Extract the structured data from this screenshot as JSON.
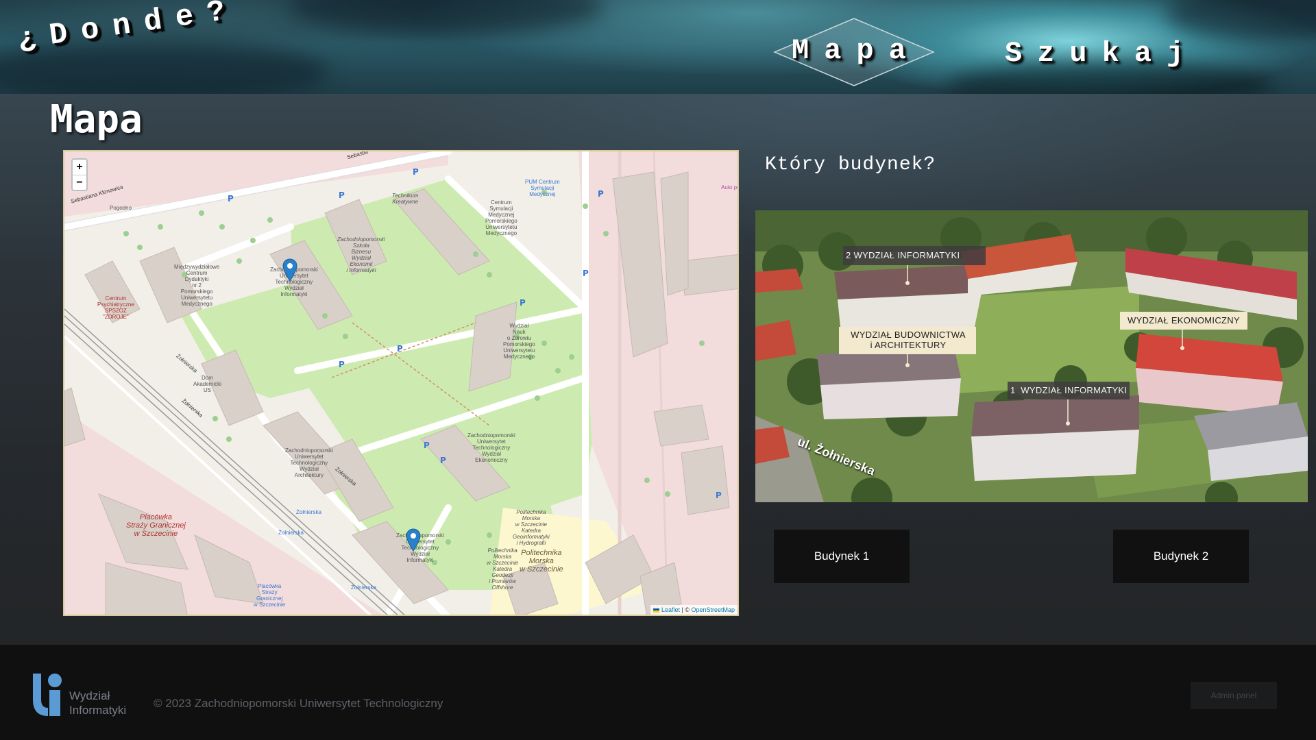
{
  "header": {
    "logo_text": "¿Donde?",
    "nav": {
      "mapa": "Mapa",
      "szukaj": "Szukaj"
    }
  },
  "main": {
    "title": "Mapa",
    "question": "Który budynek?",
    "map": {
      "zoom_in": "+",
      "zoom_out": "−",
      "attribution_leaflet": "Leaflet",
      "attribution_separator": " | © ",
      "attribution_osm": "OpenStreetMap",
      "labels": {
        "street_sebastiana": "Sebastiana Klonowica",
        "street_sebastia": "Sebastia",
        "street_zolnierska_1": "Żołnierska",
        "street_zolnierska_2": "Żołnierska",
        "street_zolnierska_3": "Żołnierska",
        "zut_wi_top": "Zachodniopomorski\nUniwersytet\nTechnologiczny\nWydział\nInformatyki",
        "zut_wi_bottom": "Zachodniopomorski\nUniwersytet\nTechnologiczny\nWydział\nInformatyki",
        "zut_architektury": "Zachodniopomorski\nUniwersytet\nTechnologiczny\nWydział\nArchitektury",
        "zut_ekonomiczny": "Zachodniopomorski\nUniwersytet\nTechnologiczny\nWydział\nEkonomiczny",
        "szkola_biznesu": "Zachodniopomorski\nSzkoła\nBiznesu\nWydział\nEkonomii\ni Informatyki",
        "centrum_dydaktyczne": "Międzywydziałowe\nCentrum\nDydaktyki\nnr 2\nPomorskiego\nUniwersytetu\nMedycznego",
        "centrum_symulacji": "Centrum\nSymulacji\nMedycznej\nPomorskiego\nUniwersytetu\nMedycznego",
        "pum_centrum": "PUM Centrum\nSymulacji\nMedycznej",
        "technikum": "Technikum\nKreatywne",
        "wydzial_nauk": "Wydział\nNauk\no Zdrowiu\nPomorskiego\nUniwersytetu\nMedycznego",
        "dom_akademicki": "Dom\nAkademicki\nUS",
        "centrum_psychiatryczne": "Centrum\nPsychiatryczne\nSPSZOZ\n\"ZDROJE\"",
        "placowka_strazy": "Placówka\nStraży Granicznej\nw Szczecinie",
        "politechnika_morska": "Politechnika\nMorska\nw Szczecinie",
        "politechnika_katedra": "Politechnika\nMorska\nw Szczecinie\nKatedra\nGeoinformatyki\ni Hydrografii",
        "politechnika_katedra2": "Politechnika\nMorska\nw Szczecinie\nKatedra\nGeodezji\ni Pomiarów\nOffshore",
        "pogodno": "Pogodno",
        "zolnierska_stop_1": "Żołnierska",
        "zolnierska_stop_2": "Żołnierska",
        "zolnierska_stop_3": "Żołnierska",
        "placowka_strazy_small": "Placówka\nStraży\nGranicznej\nw Szczecinie",
        "auto_pm": "Auto pm"
      }
    },
    "photo": {
      "label_wi": "2 WYDZIAŁ INFORMATYKI",
      "label_wb": "WYDZIAŁ BUDOWNICTWA\ni ARCHITEKTURY",
      "label_we": "WYDZIAŁ EKONOMICZNY",
      "label_wi1": "1  WYDZIAŁ INFORMATYKI",
      "label_street": "ul. Żołnierska"
    },
    "buttons": {
      "budynek_1": "Budynek 1",
      "budynek_2": "Budynek 2"
    }
  },
  "footer": {
    "logo_line1": "Wydział",
    "logo_line2": "Informatyki",
    "copyright": "© 2023 Zachodniopomorski Uniwersytet Technologiczny",
    "admin_button": "Admin panel"
  },
  "colors": {
    "map_background": "#f2efe9",
    "map_green": "#c8facc",
    "map_building": "#d9d0c9",
    "map_residential": "#f0d8d8",
    "marker_blue": "#2a81cb",
    "button_bg": "#111111",
    "footer_bg": "#101010",
    "logo_blue": "#5b9bd5"
  },
  "icons": {
    "marker": "map-marker-icon",
    "parking": "parking-icon",
    "flag": "ukraine-flag-icon",
    "logo": "wi-logo-icon"
  }
}
